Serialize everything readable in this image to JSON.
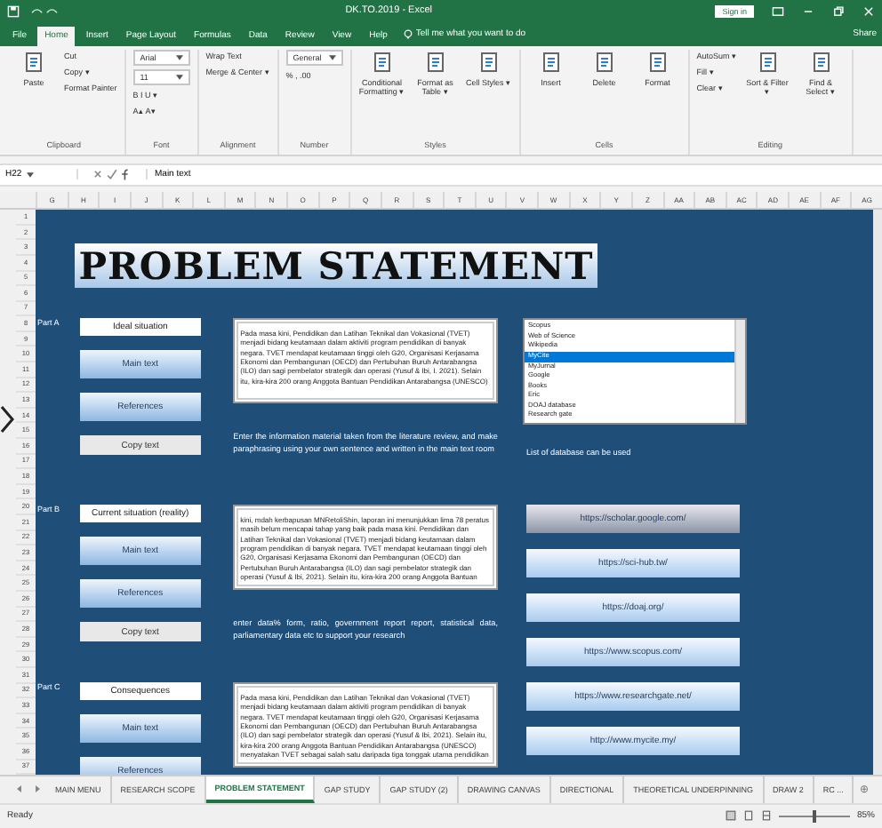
{
  "window": {
    "title": "DK.TO.2019 - Excel",
    "sign_in": "Sign in",
    "share": "Share"
  },
  "menu": [
    {
      "label": "File",
      "selected": false
    },
    {
      "label": "Home",
      "selected": true
    },
    {
      "label": "Insert",
      "selected": false
    },
    {
      "label": "Page Layout",
      "selected": false
    },
    {
      "label": "Formulas",
      "selected": false
    },
    {
      "label": "Data",
      "selected": false
    },
    {
      "label": "Review",
      "selected": false
    },
    {
      "label": "View",
      "selected": false
    },
    {
      "label": "Help",
      "selected": false
    }
  ],
  "tell_me": {
    "placeholder": "Tell me what you want to do"
  },
  "ribbon": [
    {
      "label": "Clipboard",
      "items": [
        {
          "kind": "big",
          "label": "Paste"
        },
        {
          "kind": "small",
          "label": "Cut"
        },
        {
          "kind": "small",
          "label": "Copy ▾"
        },
        {
          "kind": "small",
          "label": "Format Painter"
        }
      ]
    },
    {
      "label": "Font",
      "items": [
        {
          "kind": "field",
          "label": "Arial"
        },
        {
          "kind": "field",
          "label": "11"
        },
        {
          "kind": "small",
          "label": "B  I  U ▾"
        },
        {
          "kind": "small",
          "label": "A▴ A▾"
        }
      ]
    },
    {
      "label": "Alignment",
      "items": [
        {
          "kind": "small",
          "label": "Wrap Text"
        },
        {
          "kind": "small",
          "label": "Merge & Center ▾"
        }
      ]
    },
    {
      "label": "Number",
      "items": [
        {
          "kind": "field",
          "label": "General"
        },
        {
          "kind": "small",
          "label": "% ,  .00"
        }
      ]
    },
    {
      "label": "Styles",
      "items": [
        {
          "kind": "big",
          "label": "Conditional Formatting ▾"
        },
        {
          "kind": "big",
          "label": "Format as Table ▾"
        },
        {
          "kind": "big",
          "label": "Cell Styles ▾"
        }
      ]
    },
    {
      "label": "Cells",
      "items": [
        {
          "kind": "big",
          "label": "Insert"
        },
        {
          "kind": "big",
          "label": "Delete"
        },
        {
          "kind": "big",
          "label": "Format"
        }
      ]
    },
    {
      "label": "Editing",
      "items": [
        {
          "kind": "small",
          "label": "AutoSum ▾"
        },
        {
          "kind": "small",
          "label": "Fill ▾"
        },
        {
          "kind": "small",
          "label": "Clear ▾"
        },
        {
          "kind": "big",
          "label": "Sort & Filter ▾"
        },
        {
          "kind": "big",
          "label": "Find & Select ▾"
        }
      ]
    }
  ],
  "formula_bar": {
    "name_box": "H22",
    "value": "Main text"
  },
  "columns": [
    "G",
    "H",
    "I",
    "J",
    "K",
    "L",
    "M",
    "N",
    "O",
    "P",
    "Q",
    "R",
    "S",
    "T",
    "U",
    "V",
    "W",
    "X",
    "Y",
    "Z",
    "AA",
    "AB",
    "AC",
    "AD",
    "AE",
    "AF",
    "AG"
  ],
  "rows": [
    "1",
    "2",
    "3",
    "4",
    "5",
    "6",
    "7",
    "8",
    "9",
    "10",
    "11",
    "12",
    "13",
    "14",
    "15",
    "16",
    "17",
    "18",
    "19",
    "20",
    "21",
    "22",
    "23",
    "24",
    "25",
    "26",
    "27",
    "28",
    "29",
    "30",
    "31",
    "32",
    "33",
    "34",
    "35",
    "36",
    "37"
  ],
  "banner": "PROBLEM STATEMENT",
  "sections": [
    {
      "part": "Part A",
      "heading": "Ideal situation",
      "buttons": [
        "Main text",
        "References",
        "Copy text"
      ],
      "text": "Pada masa kini, Pendidikan dan Latihan Teknikal dan Vokasional (TVET) menjadi bidang keutamaan dalam aktiviti program pendidikan di banyak negara. TVET mendapat keutamaan tinggi oleh G20, Organisasi Kerjasama Ekonomi dan Pembangunan (OECD) dan Pertubuhan Buruh Antarabangsa (ILO) dan sagi pembelator strategik dan operasi (Yusuf & Ibi, I. 2021). Selain itu, kira-kira 200 orang Anggota Bantuan Pendidikan Antarabangsa (UNESCO)",
      "caption": "Enter the information material taken from the literature review, and make paraphrasing using your own sentence and written in the main text room"
    },
    {
      "part": "Part B",
      "heading": "Current situation (reality)",
      "buttons": [
        "Main text",
        "References",
        "Copy text"
      ],
      "text": "kini, mdah kerbapusan MNRetoliShin, laporan ini menunjukkan lima 78 peratus masih belum mencapai tahap yang baik pada masa kini. Pendidikan dan Latihan Teknikal dan Vokasional (TVET) menjadi bidang keutamaan dalam program pendidikan di banyak negara. TVET mendapat keutamaan tinggi oleh G20, Organisasi Kerjasama Ekonomi dan Pembangunan (OECD) dan Pertubuhan Buruh Antarabangsa (ILO) dan sagi pembelator strategik dan operasi (Yusuf & Ibi, 2021). Selain itu, kira-kira 200 orang Anggota Bantuan",
      "caption": "enter data% form, ratio, government report report, statistical data, parliamentary data etc to support your research"
    },
    {
      "part": "Part C",
      "heading": "Consequences",
      "buttons": [
        "Main text",
        "References"
      ],
      "text": "Pada masa kini, Pendidikan dan Latihan Teknikal dan Vokasional (TVET) menjadi bidang keutamaan dalam aktiviti program pendidikan di banyak negara. TVET mendapat keutamaan tinggi oleh G20, Organisasi Kerjasama Ekonomi dan Pembangunan (OECD) dan Pertubuhan Buruh Antarabangsa (ILO) dan sagi pembelator strategik dan operasi (Yusuf & Ibi, 2021). Selain itu, kira-kira 200 orang Anggota Bantuan Pendidikan Antarabangsa (UNESCO) menyatakan TVET sebagai salah satu daripada tiga tonggak utama pendidikan"
    }
  ],
  "database_list": [
    {
      "label": "Scopus",
      "selected": false
    },
    {
      "label": "Web of Science",
      "selected": false
    },
    {
      "label": "Wikipedia",
      "selected": false
    },
    {
      "label": "MyCite",
      "selected": true
    },
    {
      "label": "MyJurnal",
      "selected": false
    },
    {
      "label": "Google",
      "selected": false
    },
    {
      "label": "Books",
      "selected": false
    },
    {
      "label": "Eric",
      "selected": false
    },
    {
      "label": "DOAJ database",
      "selected": false
    },
    {
      "label": "Research gate",
      "selected": false
    }
  ],
  "database_caption": "List of database can be used",
  "links": [
    {
      "label": "https://scholar.google.com/",
      "selected": true
    },
    {
      "label": "https://sci-hub.tw/",
      "selected": false
    },
    {
      "label": "https://doaj.org/",
      "selected": false
    },
    {
      "label": "https://www.scopus.com/",
      "selected": false
    },
    {
      "label": "https://www.researchgate.net/",
      "selected": false
    },
    {
      "label": "http://www.mycite.my/",
      "selected": false
    }
  ],
  "sheet_tabs": [
    {
      "label": "MAIN MENU",
      "selected": false
    },
    {
      "label": "RESEARCH SCOPE",
      "selected": false
    },
    {
      "label": "PROBLEM STATEMENT",
      "selected": true
    },
    {
      "label": "GAP STUDY",
      "selected": false
    },
    {
      "label": "GAP STUDY (2)",
      "selected": false
    },
    {
      "label": "DRAWING CANVAS",
      "selected": false
    },
    {
      "label": "DIRECTIONAL",
      "selected": false
    },
    {
      "label": "THEORETICAL UNDERPINNING",
      "selected": false
    },
    {
      "label": "DRAW 2",
      "selected": false
    },
    {
      "label": "RC ...",
      "selected": false
    }
  ],
  "add_sheet": "⊕",
  "status_bar": {
    "text": "Ready",
    "zoom": {
      "level": 0.5,
      "reading": "85%"
    }
  }
}
